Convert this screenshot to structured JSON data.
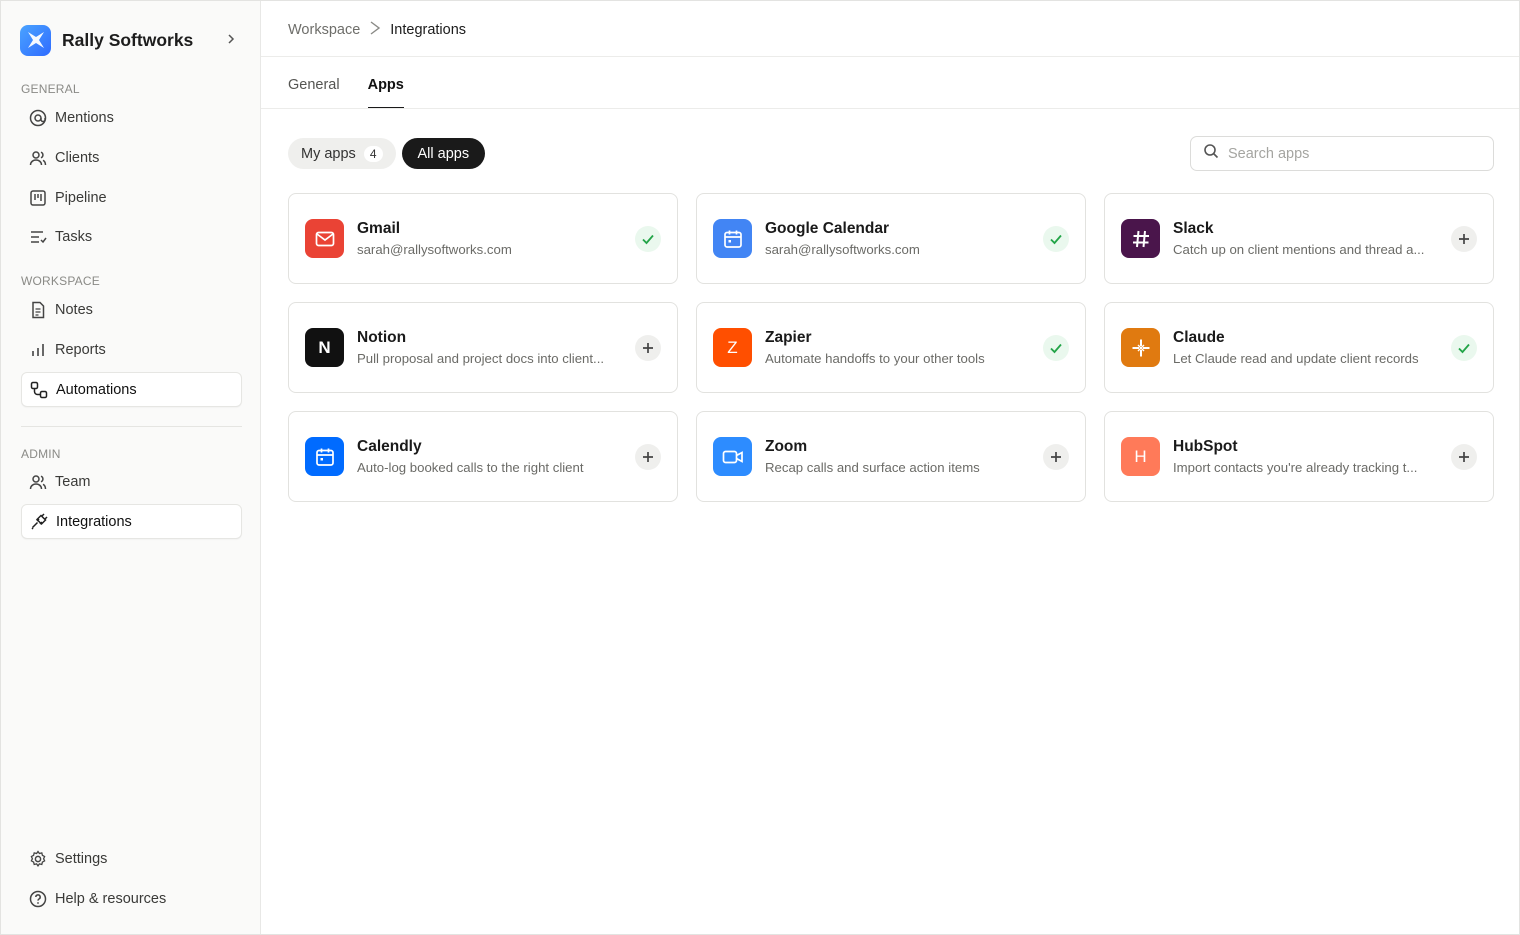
{
  "workspace": {
    "name": "Rally Softworks"
  },
  "sidebar": {
    "sections": {
      "general": "GENERAL",
      "workspace": "WORKSPACE",
      "admin": "ADMIN"
    },
    "items": {
      "mentions": {
        "label": "Mentions",
        "icon": "at-icon"
      },
      "clients": {
        "label": "Clients",
        "icon": "users-icon"
      },
      "pipeline": {
        "label": "Pipeline",
        "icon": "kanban-icon"
      },
      "tasks": {
        "label": "Tasks",
        "icon": "list-icon"
      },
      "notes": {
        "label": "Notes",
        "icon": "document-icon"
      },
      "reports": {
        "label": "Reports",
        "icon": "bar-chart-icon"
      },
      "automations": {
        "label": "Automations",
        "icon": "workflow-icon"
      },
      "team": {
        "label": "Team",
        "icon": "users-icon"
      },
      "integrations": {
        "label": "Integrations",
        "icon": "plug-icon"
      },
      "settings": {
        "label": "Settings",
        "icon": "gear-icon"
      },
      "help": {
        "label": "Help & resources",
        "icon": "help-circle-icon"
      }
    }
  },
  "breadcrumb": {
    "parent": "Workspace",
    "current": "Integrations"
  },
  "tabs": {
    "general": "General",
    "apps": "Apps"
  },
  "filters": {
    "my_apps": "My apps",
    "my_apps_count": "4",
    "all_apps": "All apps"
  },
  "search": {
    "placeholder": "Search apps"
  },
  "apps": [
    {
      "name": "Gmail",
      "description": "sarah@rallysoftworks.com",
      "color": "#ea4335",
      "status": "connected"
    },
    {
      "name": "Google Calendar",
      "description": "sarah@rallysoftworks.com",
      "color": "#4285f4",
      "status": "connected"
    },
    {
      "name": "Slack",
      "description": "Catch up on client mentions and thread a...",
      "color": "#4a154b",
      "status": "add"
    },
    {
      "name": "Notion",
      "description": "Pull proposal and project docs into client...",
      "color": "#111111",
      "letter": "N",
      "status": "add"
    },
    {
      "name": "Zapier",
      "description": "Automate handoffs to your other tools",
      "color": "#ff4f00",
      "letter": "Z",
      "status": "connected"
    },
    {
      "name": "Claude",
      "description": "Let Claude read and update client records",
      "color": "#e07a10",
      "status": "connected"
    },
    {
      "name": "Calendly",
      "description": "Auto-log booked calls to the right client",
      "color": "#006bff",
      "status": "add"
    },
    {
      "name": "Zoom",
      "description": "Recap calls and surface action items",
      "color": "#2d8cff",
      "status": "add"
    },
    {
      "name": "HubSpot",
      "description": "Import contacts you're already tracking t...",
      "color": "#ff7a59",
      "letter": "H",
      "status": "add"
    }
  ],
  "colors": {
    "accent": "#1a1a1a",
    "connected": "#22a447"
  }
}
